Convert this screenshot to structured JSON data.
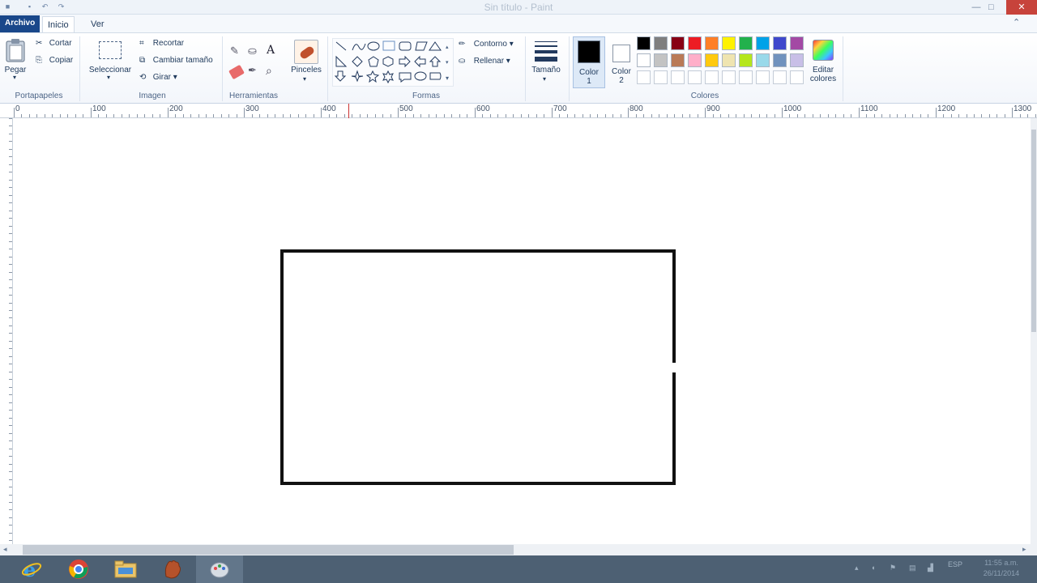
{
  "window": {
    "title": "Sin título - Paint",
    "close_glyph": "✕",
    "minimize_glyph": "—",
    "maximize_glyph": "□"
  },
  "tabs": [
    {
      "label": "Archivo"
    },
    {
      "label": "Inicio"
    },
    {
      "label": "Ver"
    }
  ],
  "ribbon": {
    "portapapeles": {
      "group_label": "Portapapeles",
      "paste": "Pegar",
      "cut": "Cortar",
      "copy": "Copiar"
    },
    "imagen": {
      "group_label": "Imagen",
      "select": "Seleccionar",
      "crop": "Recortar",
      "resize": "Cambiar tamaño",
      "rotate": "Girar ▾"
    },
    "herramientas": {
      "group_label": "Herramientas",
      "brushes": "Pinceles"
    },
    "formas": {
      "group_label": "Formas",
      "outline": "Contorno ▾",
      "fill": "Rellenar ▾"
    },
    "size": "Tamaño",
    "color1": {
      "line1": "Color",
      "line2": "1"
    },
    "color2": {
      "line1": "Color",
      "line2": "2"
    },
    "colores": {
      "group_label": "Colores",
      "edit_line1": "Editar",
      "edit_line2": "colores"
    },
    "palette_row1": [
      "#000000",
      "#7f7f7f",
      "#880015",
      "#ed1c24",
      "#ff7f27",
      "#fff200",
      "#22b14c",
      "#00a2e8",
      "#3f48cc",
      "#a349a4"
    ],
    "palette_row2": [
      "#ffffff",
      "#c3c3c3",
      "#b97a57",
      "#ffaec9",
      "#ffc90e",
      "#efe4b0",
      "#b5e61d",
      "#99d9ea",
      "#7092be",
      "#c8bfe7"
    ],
    "current_color1": "#000000",
    "current_color2": "#ffffff"
  },
  "ruler": {
    "labels": [
      "0",
      "100",
      "200",
      "300",
      "400",
      "500",
      "600",
      "700",
      "800",
      "900",
      "1000",
      "1100",
      "1200",
      "1300"
    ]
  },
  "taskbar": {
    "items": [
      "internet-explorer",
      "chrome",
      "file-explorer",
      "baseball-glove-app",
      "paint"
    ],
    "clock_time": "11:55 a.m.",
    "clock_date": "26/11/2014",
    "lang": "ESP"
  }
}
